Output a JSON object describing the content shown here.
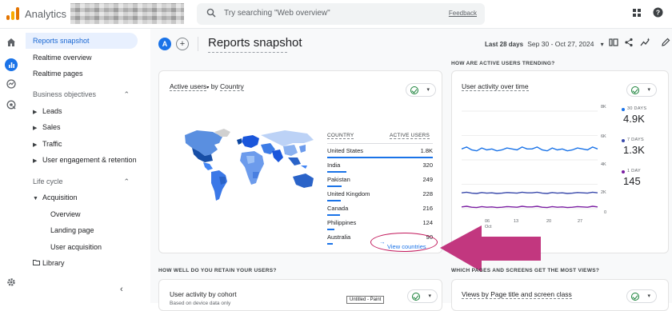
{
  "topbar": {
    "brand": "Analytics",
    "search_placeholder": "Try searching \"Web overview\"",
    "feedback": "Feedback"
  },
  "sidenav": {
    "items": [
      {
        "label": "Reports snapshot",
        "selected": true
      },
      {
        "label": "Realtime overview"
      },
      {
        "label": "Realtime pages"
      },
      {
        "label": "Business objectives",
        "section": true
      },
      {
        "label": "Leads"
      },
      {
        "label": "Sales"
      },
      {
        "label": "Traffic"
      },
      {
        "label": "User engagement & retention"
      },
      {
        "label": "Life cycle",
        "section": true
      },
      {
        "label": "Acquisition"
      },
      {
        "label": "Overview"
      },
      {
        "label": "Landing page"
      },
      {
        "label": "User acquisition"
      },
      {
        "label": "Library"
      }
    ]
  },
  "header": {
    "avatar": "A",
    "title": "Reports snapshot",
    "range_label": "Last 28 days",
    "range_value": "Sep 30 - Oct 27, 2024"
  },
  "sections": {
    "trending": "HOW ARE ACTIVE USERS TRENDING?",
    "retain": "HOW WELL DO YOU RETAIN YOUR USERS?",
    "pages": "WHICH PAGES AND SCREENS GET THE MOST VIEWS?"
  },
  "country_card": {
    "title_metric": "Active users",
    "title_by": "by",
    "title_dim": "Country",
    "col_country": "COUNTRY",
    "col_users": "ACTIVE USERS",
    "rows": [
      {
        "country": "United States",
        "users": "1.8K",
        "share": 1.0
      },
      {
        "country": "India",
        "users": "320",
        "share": 0.18
      },
      {
        "country": "Pakistan",
        "users": "249",
        "share": 0.14
      },
      {
        "country": "United Kingdom",
        "users": "228",
        "share": 0.13
      },
      {
        "country": "Canada",
        "users": "216",
        "share": 0.12
      },
      {
        "country": "Philippines",
        "users": "124",
        "share": 0.07
      },
      {
        "country": "Australia",
        "users": "90",
        "share": 0.05
      }
    ],
    "view_link": "View countries"
  },
  "activity_card": {
    "title": "User activity over time",
    "legend": [
      {
        "label": "30 DAYS",
        "value": "4.9K",
        "color": "#1a73e8"
      },
      {
        "label": "7 DAYS",
        "value": "1.3K",
        "color": "#3949ab"
      },
      {
        "label": "1 DAY",
        "value": "145",
        "color": "#7b1fa2"
      }
    ],
    "y_ticks": [
      "8K",
      "6K",
      "4K",
      "2K",
      "0"
    ],
    "x_ticks": [
      "06",
      "13",
      "20",
      "27"
    ],
    "x_month": "Oct"
  },
  "cohort_card": {
    "title": "User activity by cohort",
    "subtitle": "Based on device data only",
    "paint_tooltip": "Untitled - Paint"
  },
  "pages_card": {
    "title": "Views by Page title and screen class"
  },
  "colors": {
    "accent": "#1a73e8",
    "annotation": "#c2185b"
  },
  "chart_data": {
    "type": "line",
    "title": "User activity over time",
    "x": [
      "06",
      "13",
      "20",
      "27"
    ],
    "ylim": [
      0,
      8000
    ],
    "series": [
      {
        "name": "30 DAYS",
        "values": [
          4900,
          4900,
          4900,
          4900
        ]
      },
      {
        "name": "7 DAYS",
        "values": [
          1300,
          1300,
          1300,
          1300
        ]
      },
      {
        "name": "1 DAY",
        "values": [
          145,
          145,
          145,
          145
        ]
      }
    ]
  }
}
